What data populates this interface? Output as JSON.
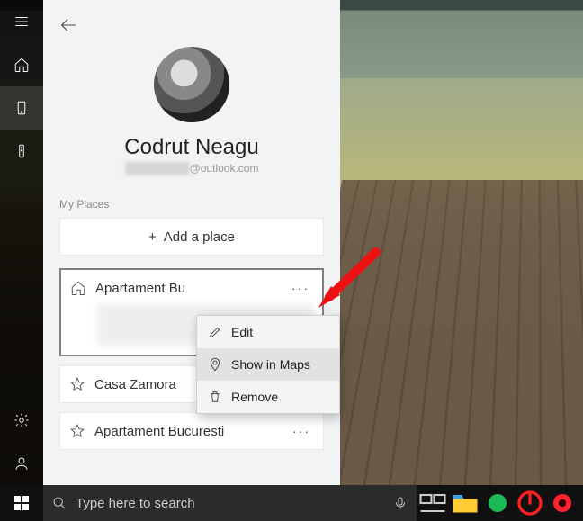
{
  "rail": {
    "items": [
      {
        "name": "hamburger-icon"
      },
      {
        "name": "home-icon"
      },
      {
        "name": "device-icon",
        "selected": true
      },
      {
        "name": "remote-icon"
      }
    ],
    "bottom": [
      {
        "name": "settings-icon"
      },
      {
        "name": "account-icon"
      }
    ]
  },
  "profile": {
    "name": "Codrut Neagu",
    "email_hidden_prefix": "████████",
    "email_suffix": "@outlook.com"
  },
  "section_label": "My Places",
  "add_place_label": "Add a place",
  "places": [
    {
      "icon": "home",
      "title": "Apartament Bu",
      "has_body": true,
      "selected": true
    },
    {
      "icon": "star",
      "title": "Casa Zamora",
      "has_body": false,
      "selected": false
    },
    {
      "icon": "star",
      "title": "Apartament Bucuresti",
      "has_body": false,
      "selected": false
    }
  ],
  "context_menu": {
    "items": [
      {
        "icon": "pencil",
        "label": "Edit"
      },
      {
        "icon": "pin",
        "label": "Show in Maps",
        "hover": true
      },
      {
        "icon": "trash",
        "label": "Remove"
      }
    ]
  },
  "taskbar": {
    "search_placeholder": "Type here to search"
  }
}
